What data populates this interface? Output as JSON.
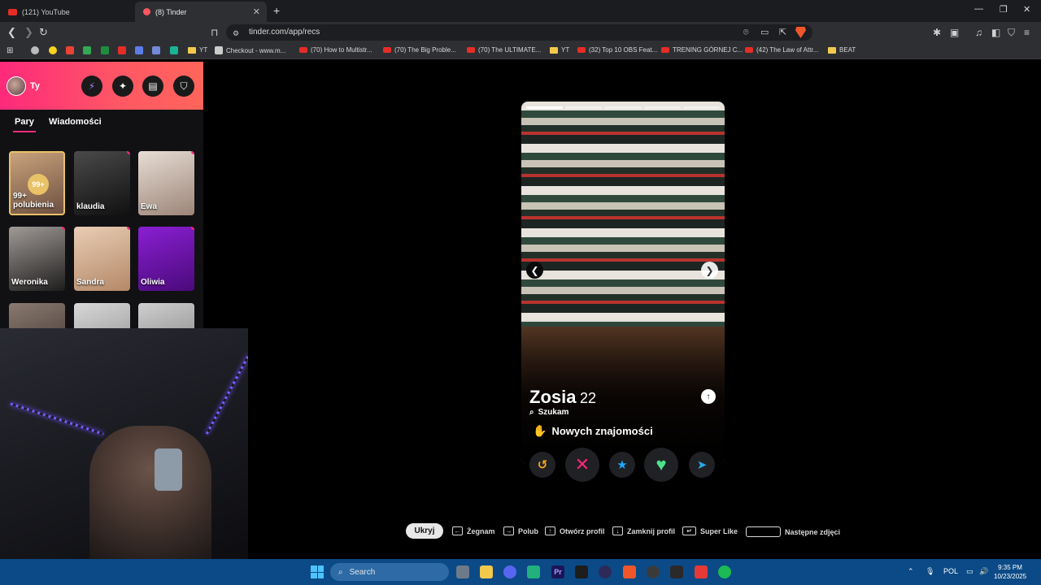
{
  "browser": {
    "tabs": [
      {
        "title": "(121) YouTube",
        "active": false
      },
      {
        "title": "(8) Tinder",
        "active": true
      }
    ],
    "url": "tinder.com/app/recs",
    "bookmarks": [
      {
        "label": "YT",
        "type": "folder"
      },
      {
        "label": "Checkout - www.m...",
        "type": "page"
      },
      {
        "label": "(70) How to Multistr...",
        "type": "youtube"
      },
      {
        "label": "(70) The Big Proble...",
        "type": "youtube"
      },
      {
        "label": "(70) The ULTIMATE...",
        "type": "youtube"
      },
      {
        "label": "YT",
        "type": "folder"
      },
      {
        "label": "(32) Top 10 OBS Feat...",
        "type": "youtube"
      },
      {
        "label": "TRENING GÓRNEJ C...",
        "type": "youtube"
      },
      {
        "label": "(42) The Law of Attr...",
        "type": "youtube"
      },
      {
        "label": "BEAT",
        "type": "folder"
      }
    ]
  },
  "sidebar": {
    "user_name": "Ty",
    "tabs": [
      "Pary",
      "Wiadomości"
    ],
    "likes": {
      "badge": "99+",
      "count": "99+",
      "label": "polubienia"
    },
    "matches": [
      {
        "name": "klaudia",
        "unread": true
      },
      {
        "name": "Ewa",
        "unread": true
      },
      {
        "name": "Weronika",
        "unread": true
      },
      {
        "name": "Sandra",
        "unread": true
      },
      {
        "name": "Oliwia",
        "unread": true
      }
    ]
  },
  "profile": {
    "name": "Zosia",
    "age": "22",
    "looking_label": "Szukam",
    "intent": "Nowych znajomości",
    "photo_count": 5,
    "current_photo": 1
  },
  "shortcuts": {
    "hide": "Ukryj",
    "items": [
      {
        "key": "←",
        "label": "Żegnam"
      },
      {
        "key": "→",
        "label": "Polub"
      },
      {
        "key": "↑",
        "label": "Otwórz profil"
      },
      {
        "key": "↓",
        "label": "Zamknij profil"
      },
      {
        "key": "↵",
        "label": "Super Like"
      },
      {
        "key": "",
        "label": "Następne zdjęci"
      }
    ]
  },
  "taskbar": {
    "search": "Search",
    "lang": "POL",
    "time": "9:35 PM",
    "date": "10/23/2025"
  },
  "colors": {
    "tinder_gradient_start": "#fd297b",
    "tinder_gradient_end": "#ff655b",
    "rewind": "#f5a623",
    "nope": "#fd267d",
    "superlike": "#1fa9ff",
    "like": "#4de28a",
    "boost": "#2aa6e8"
  }
}
